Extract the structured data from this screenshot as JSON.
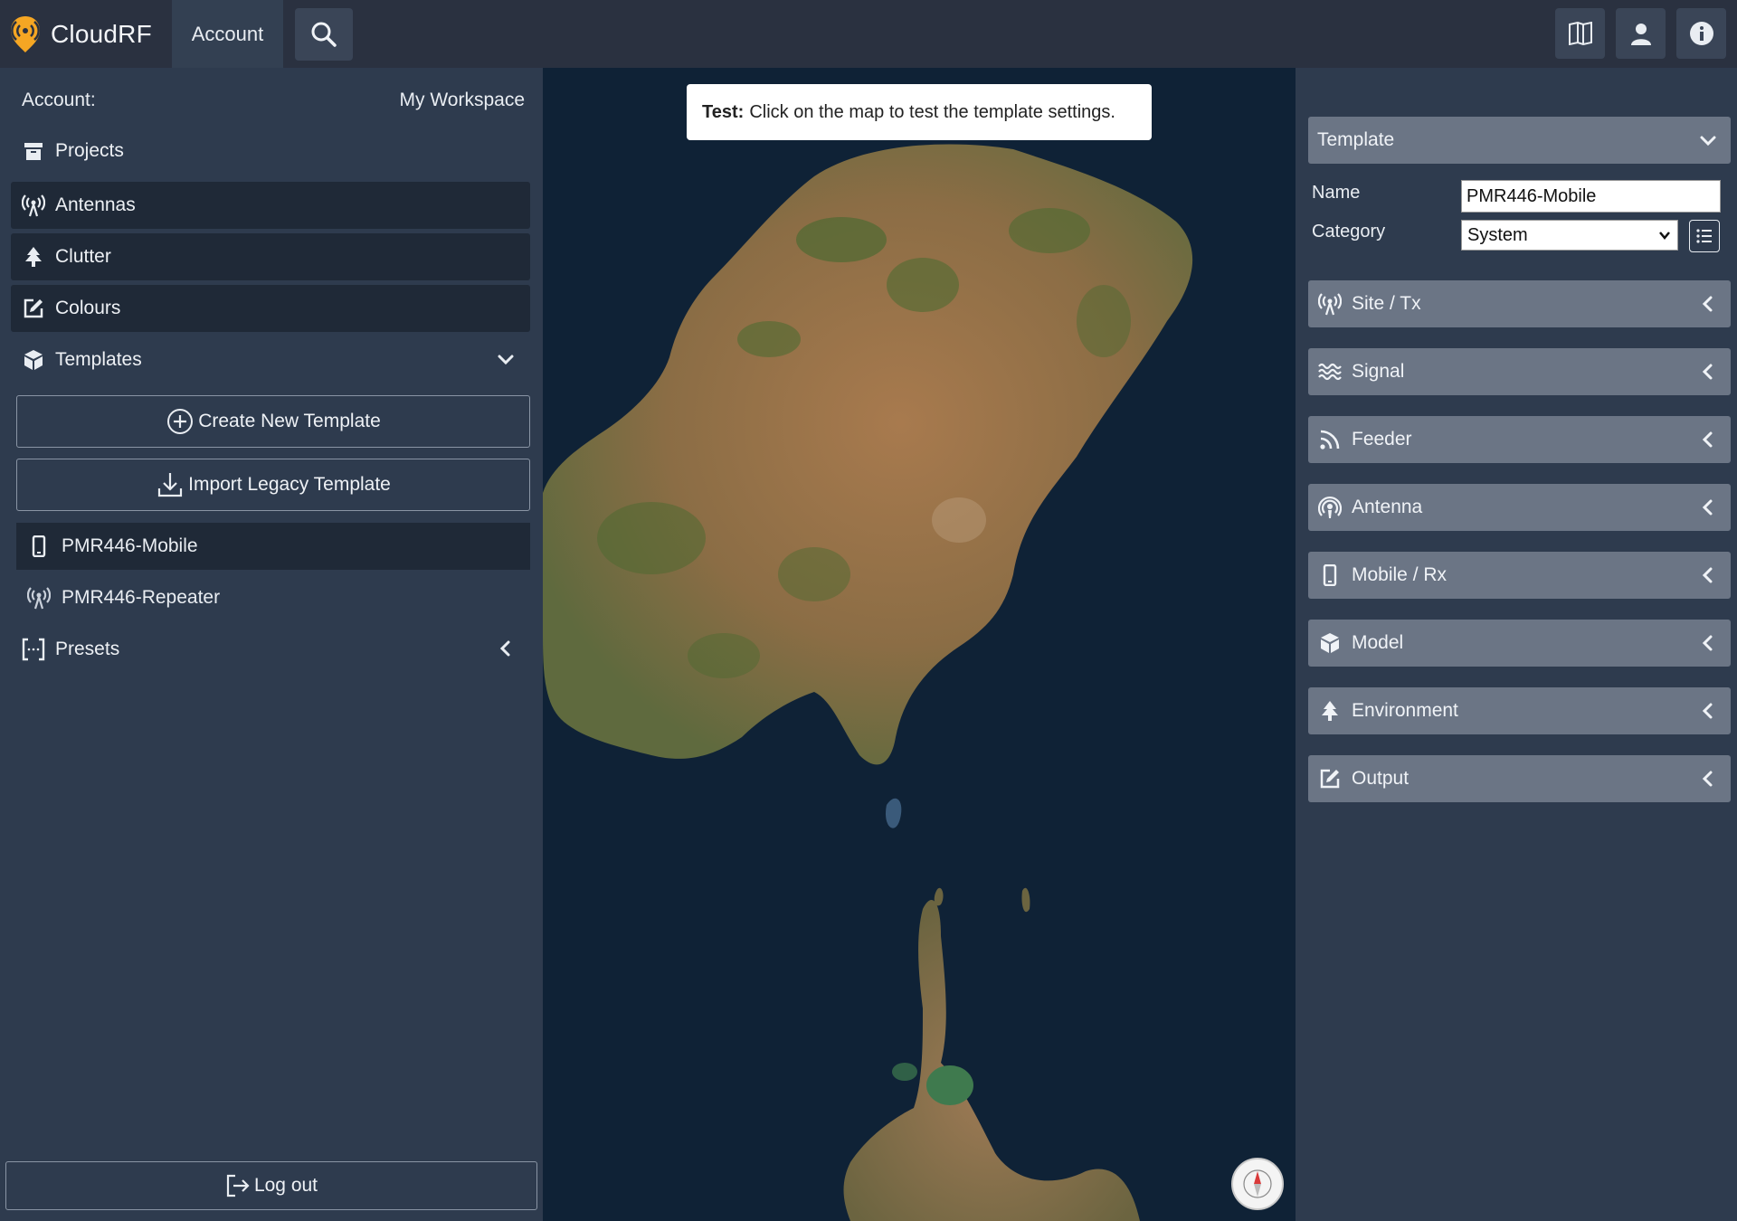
{
  "topbar": {
    "brand": "CloudRF",
    "account_tab": "Account",
    "icons": [
      "search-icon",
      "book-icon",
      "user-icon",
      "info-icon"
    ]
  },
  "sidebar": {
    "account_label": "Account:",
    "workspace": "My Workspace",
    "items": {
      "projects": "Projects",
      "antennas": "Antennas",
      "clutter": "Clutter",
      "colours": "Colours",
      "templates": "Templates",
      "presets": "Presets"
    },
    "create_template": "Create New Template",
    "import_template": "Import Legacy Template",
    "templates": [
      "PMR446-Mobile",
      "PMR446-Repeater"
    ],
    "logout": "Log out"
  },
  "map": {
    "toast_bold": "Test:",
    "toast_text": "Click on the map to test the template settings."
  },
  "right_panel": {
    "template_header": "Template",
    "name_label": "Name",
    "name_value": "PMR446-Mobile",
    "category_label": "Category",
    "category_value": "System",
    "sections": [
      "Site / Tx",
      "Signal",
      "Feeder",
      "Antenna",
      "Mobile / Rx",
      "Model",
      "Environment",
      "Output"
    ]
  },
  "colors": {
    "topbar": "#2a3140",
    "sidebar": "#2e3b4e",
    "active_item": "#1f2937",
    "accordion": "#6b7585",
    "logo_orange": "#f5a623"
  }
}
